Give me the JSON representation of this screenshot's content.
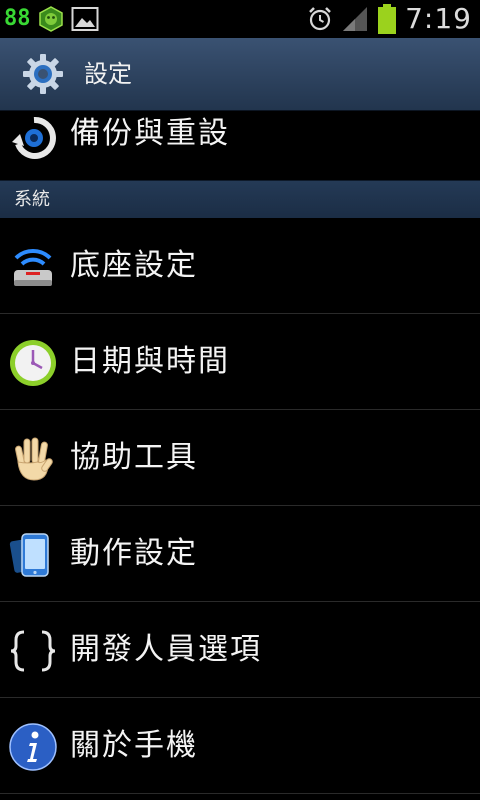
{
  "statusbar": {
    "left_number": "88",
    "icons": [
      "notification-badge-icon",
      "gallery-image-icon"
    ],
    "right_icons": [
      "alarm-clock-icon",
      "signal-strength-icon",
      "battery-icon"
    ],
    "time": "7:19",
    "battery_color": "#9bd21d"
  },
  "titlebar": {
    "icon": "settings-gear-icon",
    "title": "設定"
  },
  "partial_item": {
    "label": "備份與重設",
    "icon": "backup-reset-icon"
  },
  "section": {
    "label": "系統"
  },
  "items": [
    {
      "label": "底座設定",
      "icon": "dock-icon"
    },
    {
      "label": "日期與時間",
      "icon": "clock-icon"
    },
    {
      "label": "協助工具",
      "icon": "hand-icon"
    },
    {
      "label": "動作設定",
      "icon": "motion-phone-icon"
    },
    {
      "label": "開發人員選項",
      "icon": "developer-braces-icon"
    },
    {
      "label": "關於手機",
      "icon": "info-icon"
    }
  ],
  "colors": {
    "title_bar": "#2d4563",
    "section_header": "#1f3450",
    "background": "#000000"
  }
}
